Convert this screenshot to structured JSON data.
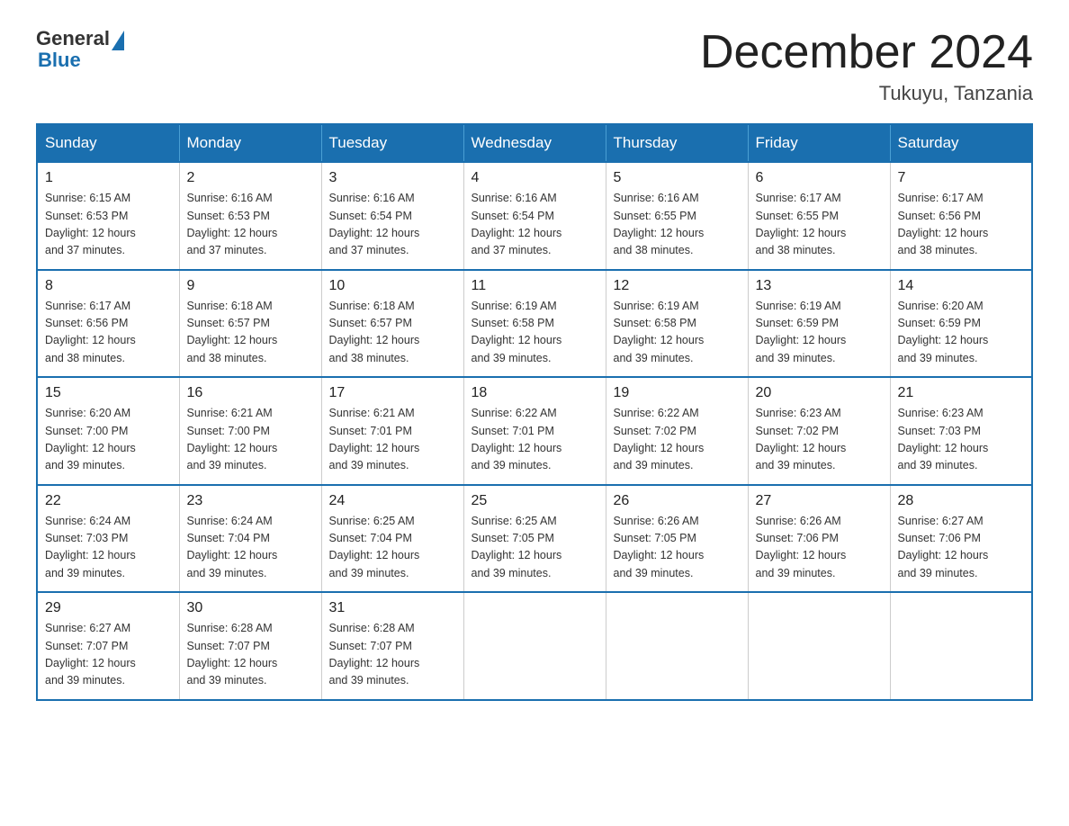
{
  "header": {
    "logo_general": "General",
    "logo_blue": "Blue",
    "month_title": "December 2024",
    "location": "Tukuyu, Tanzania"
  },
  "calendar": {
    "days_of_week": [
      "Sunday",
      "Monday",
      "Tuesday",
      "Wednesday",
      "Thursday",
      "Friday",
      "Saturday"
    ],
    "weeks": [
      [
        {
          "day": "1",
          "sunrise": "6:15 AM",
          "sunset": "6:53 PM",
          "daylight": "12 hours and 37 minutes."
        },
        {
          "day": "2",
          "sunrise": "6:16 AM",
          "sunset": "6:53 PM",
          "daylight": "12 hours and 37 minutes."
        },
        {
          "day": "3",
          "sunrise": "6:16 AM",
          "sunset": "6:54 PM",
          "daylight": "12 hours and 37 minutes."
        },
        {
          "day": "4",
          "sunrise": "6:16 AM",
          "sunset": "6:54 PM",
          "daylight": "12 hours and 37 minutes."
        },
        {
          "day": "5",
          "sunrise": "6:16 AM",
          "sunset": "6:55 PM",
          "daylight": "12 hours and 38 minutes."
        },
        {
          "day": "6",
          "sunrise": "6:17 AM",
          "sunset": "6:55 PM",
          "daylight": "12 hours and 38 minutes."
        },
        {
          "day": "7",
          "sunrise": "6:17 AM",
          "sunset": "6:56 PM",
          "daylight": "12 hours and 38 minutes."
        }
      ],
      [
        {
          "day": "8",
          "sunrise": "6:17 AM",
          "sunset": "6:56 PM",
          "daylight": "12 hours and 38 minutes."
        },
        {
          "day": "9",
          "sunrise": "6:18 AM",
          "sunset": "6:57 PM",
          "daylight": "12 hours and 38 minutes."
        },
        {
          "day": "10",
          "sunrise": "6:18 AM",
          "sunset": "6:57 PM",
          "daylight": "12 hours and 38 minutes."
        },
        {
          "day": "11",
          "sunrise": "6:19 AM",
          "sunset": "6:58 PM",
          "daylight": "12 hours and 39 minutes."
        },
        {
          "day": "12",
          "sunrise": "6:19 AM",
          "sunset": "6:58 PM",
          "daylight": "12 hours and 39 minutes."
        },
        {
          "day": "13",
          "sunrise": "6:19 AM",
          "sunset": "6:59 PM",
          "daylight": "12 hours and 39 minutes."
        },
        {
          "day": "14",
          "sunrise": "6:20 AM",
          "sunset": "6:59 PM",
          "daylight": "12 hours and 39 minutes."
        }
      ],
      [
        {
          "day": "15",
          "sunrise": "6:20 AM",
          "sunset": "7:00 PM",
          "daylight": "12 hours and 39 minutes."
        },
        {
          "day": "16",
          "sunrise": "6:21 AM",
          "sunset": "7:00 PM",
          "daylight": "12 hours and 39 minutes."
        },
        {
          "day": "17",
          "sunrise": "6:21 AM",
          "sunset": "7:01 PM",
          "daylight": "12 hours and 39 minutes."
        },
        {
          "day": "18",
          "sunrise": "6:22 AM",
          "sunset": "7:01 PM",
          "daylight": "12 hours and 39 minutes."
        },
        {
          "day": "19",
          "sunrise": "6:22 AM",
          "sunset": "7:02 PM",
          "daylight": "12 hours and 39 minutes."
        },
        {
          "day": "20",
          "sunrise": "6:23 AM",
          "sunset": "7:02 PM",
          "daylight": "12 hours and 39 minutes."
        },
        {
          "day": "21",
          "sunrise": "6:23 AM",
          "sunset": "7:03 PM",
          "daylight": "12 hours and 39 minutes."
        }
      ],
      [
        {
          "day": "22",
          "sunrise": "6:24 AM",
          "sunset": "7:03 PM",
          "daylight": "12 hours and 39 minutes."
        },
        {
          "day": "23",
          "sunrise": "6:24 AM",
          "sunset": "7:04 PM",
          "daylight": "12 hours and 39 minutes."
        },
        {
          "day": "24",
          "sunrise": "6:25 AM",
          "sunset": "7:04 PM",
          "daylight": "12 hours and 39 minutes."
        },
        {
          "day": "25",
          "sunrise": "6:25 AM",
          "sunset": "7:05 PM",
          "daylight": "12 hours and 39 minutes."
        },
        {
          "day": "26",
          "sunrise": "6:26 AM",
          "sunset": "7:05 PM",
          "daylight": "12 hours and 39 minutes."
        },
        {
          "day": "27",
          "sunrise": "6:26 AM",
          "sunset": "7:06 PM",
          "daylight": "12 hours and 39 minutes."
        },
        {
          "day": "28",
          "sunrise": "6:27 AM",
          "sunset": "7:06 PM",
          "daylight": "12 hours and 39 minutes."
        }
      ],
      [
        {
          "day": "29",
          "sunrise": "6:27 AM",
          "sunset": "7:07 PM",
          "daylight": "12 hours and 39 minutes."
        },
        {
          "day": "30",
          "sunrise": "6:28 AM",
          "sunset": "7:07 PM",
          "daylight": "12 hours and 39 minutes."
        },
        {
          "day": "31",
          "sunrise": "6:28 AM",
          "sunset": "7:07 PM",
          "daylight": "12 hours and 39 minutes."
        },
        null,
        null,
        null,
        null
      ]
    ],
    "sunrise_label": "Sunrise:",
    "sunset_label": "Sunset:",
    "daylight_label": "Daylight:"
  }
}
